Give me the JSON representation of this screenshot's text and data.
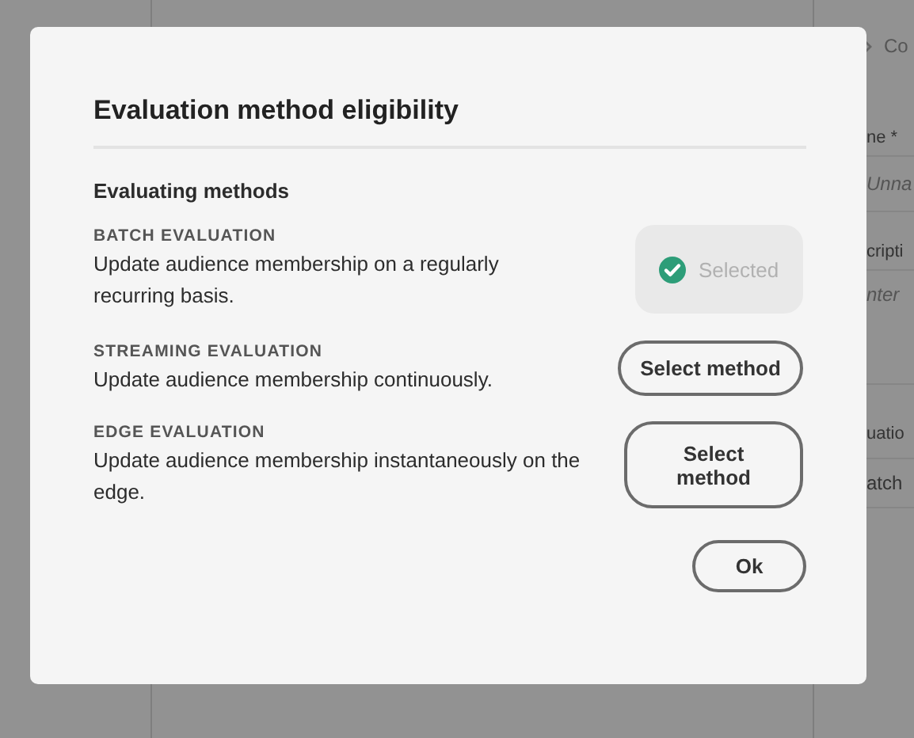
{
  "background_panel": {
    "items": [
      {
        "kind": "link",
        "text": "Co"
      },
      {
        "kind": "label",
        "text": "ne *"
      },
      {
        "kind": "placeholder",
        "text": "Unna"
      },
      {
        "kind": "label",
        "text": "cripti"
      },
      {
        "kind": "placeholder",
        "text": "nter"
      },
      {
        "kind": "label",
        "text": "uatio"
      },
      {
        "kind": "value",
        "text": "atch"
      }
    ]
  },
  "dialog": {
    "title": "Evaluation method eligibility",
    "section_heading": "Evaluating methods",
    "methods": [
      {
        "label": "BATCH EVALUATION",
        "description": "Update audience membership on a regularly recurring basis.",
        "selected": true,
        "button": "Selected"
      },
      {
        "label": "STREAMING EVALUATION",
        "description": "Update audience membership continuously.",
        "selected": false,
        "button": "Select method"
      },
      {
        "label": "EDGE EVALUATION",
        "description": "Update audience membership instantaneously on the edge.",
        "selected": false,
        "button": "Select method"
      }
    ],
    "ok_button": "Ok"
  }
}
